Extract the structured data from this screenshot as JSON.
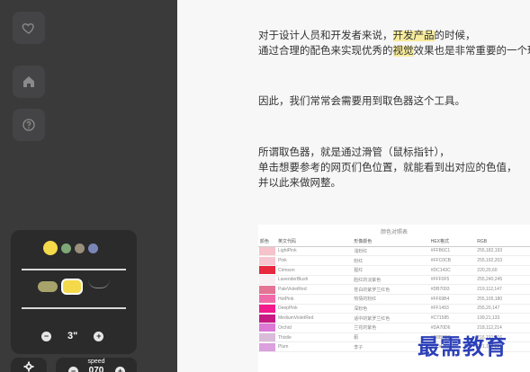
{
  "sidebar": {
    "buttons": [
      {
        "name": "heart-icon"
      },
      {
        "name": "home-icon"
      },
      {
        "name": "help-icon"
      }
    ],
    "panel": {
      "swatch_colors": [
        "#f4d94a",
        "#7fa878",
        "#9a8f7a",
        "#7a86b8"
      ],
      "stepper_value": "3\"",
      "minus_label": "−",
      "plus_label": "+"
    },
    "speed": {
      "label": "speed",
      "value": "070",
      "minus_label": "−",
      "plus_label": "+"
    }
  },
  "document": {
    "paragraphs": [
      {
        "lines": [
          {
            "pre": "对于设计人员和开发者来说，",
            "hl": "开发产品",
            "post": "的时候，"
          },
          {
            "pre": "通过合理的配色来实现优秀的",
            "hl": "视觉",
            "post": "效果也是非常重要的一个环节"
          }
        ]
      },
      {
        "lines": [
          {
            "pre": "因此，我们常常会需要用到取色器这个工具。",
            "hl": "",
            "post": ""
          }
        ]
      },
      {
        "lines": [
          {
            "pre": "所谓取色器，就是通过滑管（鼠标指针），",
            "hl": "",
            "post": ""
          },
          {
            "pre": "单击想要参考的网页们色位置，就能看到出对应的色值，",
            "hl": "",
            "post": ""
          },
          {
            "pre": "并以此来做网整。",
            "hl": "",
            "post": ""
          }
        ]
      }
    ],
    "table": {
      "title": "颜色对照表",
      "headers": [
        "颜色",
        "英文代码",
        "形像颜色",
        "HEX格式",
        "RGB"
      ],
      "rows": [
        {
          "color": "#f6c2cb",
          "en": "LightPink",
          "cn": "浅粉红",
          "hex": "#FFB6C1",
          "rgb": "255,182,193"
        },
        {
          "color": "#f7c6d0",
          "en": "Pink",
          "cn": "粉红",
          "hex": "#FFC0CB",
          "rgb": "255,192,203"
        },
        {
          "color": "#e8283f",
          "en": "Crimson",
          "cn": "猩红",
          "hex": "#DC143C",
          "rgb": "220,20,60"
        },
        {
          "color": "#f9eef2",
          "en": "LavenderBlush",
          "cn": "脸红的淡紫色",
          "hex": "#FFF0F5",
          "rgb": "255,240,245"
        },
        {
          "color": "#e57393",
          "en": "PaleVioletRed",
          "cn": "苍白的紫罗兰红色",
          "hex": "#DB7093",
          "rgb": "219,112,147"
        },
        {
          "color": "#f06aa8",
          "en": "HotPink",
          "cn": "热情的粉红",
          "hex": "#FF69B4",
          "rgb": "255,105,180"
        },
        {
          "color": "#f21b8c",
          "en": "DeepPink",
          "cn": "深粉色",
          "hex": "#FF1493",
          "rgb": "255,20,147"
        },
        {
          "color": "#c71b84",
          "en": "MediumVioletRed",
          "cn": "适中的紫罗兰红色",
          "hex": "#C71585",
          "rgb": "199,21,133"
        },
        {
          "color": "#db79d4",
          "en": "Orchid",
          "cn": "兰花的紫色",
          "hex": "#DA70D6",
          "rgb": "218,112,214"
        },
        {
          "color": "#d9bcd9",
          "en": "Thistle",
          "cn": "蓟",
          "hex": "#D8BFD8",
          "rgb": "216,191,216"
        },
        {
          "color": "#dba0dd",
          "en": "Plum",
          "cn": "李子",
          "hex": "#DDA0DD",
          "rgb": "221,160,221"
        }
      ]
    }
  },
  "watermark": "最需教育"
}
